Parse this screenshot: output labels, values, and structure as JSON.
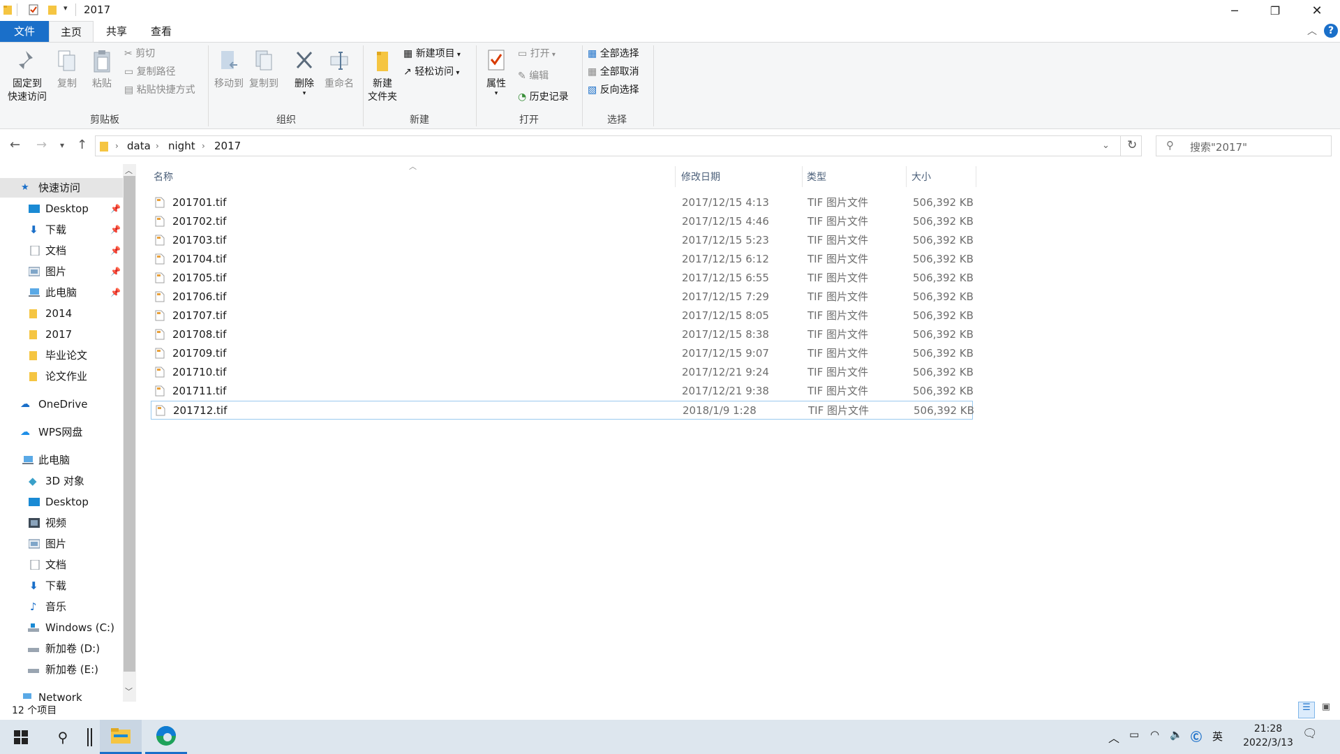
{
  "window": {
    "title": "2017"
  },
  "tabs": {
    "file": "文件",
    "home": "主页",
    "share": "共享",
    "view": "查看"
  },
  "ribbon": {
    "clipboard": {
      "pin": "固定到\n快速访问",
      "pin_l1": "固定到",
      "pin_l2": "快速访问",
      "copy": "复制",
      "paste": "粘贴",
      "cut": "剪切",
      "copy_path": "复制路径",
      "paste_shortcut": "粘贴快捷方式",
      "label": "剪贴板"
    },
    "organize": {
      "move_to": "移动到",
      "copy_to": "复制到",
      "delete": "删除",
      "rename": "重命名",
      "label": "组织"
    },
    "new": {
      "new_folder_l1": "新建",
      "new_folder_l2": "文件夹",
      "new_item": "新建项目",
      "easy_access": "轻松访问",
      "label": "新建"
    },
    "open": {
      "properties": "属性",
      "open": "打开",
      "edit": "编辑",
      "history": "历史记录",
      "label": "打开"
    },
    "select": {
      "select_all": "全部选择",
      "select_none": "全部取消",
      "invert": "反向选择",
      "label": "选择"
    }
  },
  "address": {
    "crumbs": [
      "data",
      "night",
      "2017"
    ],
    "search_placeholder": "搜索\"2017\""
  },
  "sidebar": {
    "quick_access": "快速访问",
    "quick_items": [
      "Desktop",
      "下载",
      "文档",
      "图片",
      "此电脑",
      "2014",
      "2017",
      "毕业论文",
      "论文作业"
    ],
    "onedrive": "OneDrive",
    "wps": "WPS网盘",
    "this_pc": "此电脑",
    "pc_items": [
      "3D 对象",
      "Desktop",
      "视频",
      "图片",
      "文档",
      "下载",
      "音乐",
      "Windows (C:)",
      "新加卷 (D:)",
      "新加卷 (E:)"
    ],
    "network": "Network"
  },
  "columns": {
    "name": "名称",
    "date": "修改日期",
    "type": "类型",
    "size": "大小"
  },
  "files": [
    {
      "name": "201701.tif",
      "date": "2017/12/15 4:13",
      "type": "TIF 图片文件",
      "size": "506,392 KB"
    },
    {
      "name": "201702.tif",
      "date": "2017/12/15 4:46",
      "type": "TIF 图片文件",
      "size": "506,392 KB"
    },
    {
      "name": "201703.tif",
      "date": "2017/12/15 5:23",
      "type": "TIF 图片文件",
      "size": "506,392 KB"
    },
    {
      "name": "201704.tif",
      "date": "2017/12/15 6:12",
      "type": "TIF 图片文件",
      "size": "506,392 KB"
    },
    {
      "name": "201705.tif",
      "date": "2017/12/15 6:55",
      "type": "TIF 图片文件",
      "size": "506,392 KB"
    },
    {
      "name": "201706.tif",
      "date": "2017/12/15 7:29",
      "type": "TIF 图片文件",
      "size": "506,392 KB"
    },
    {
      "name": "201707.tif",
      "date": "2017/12/15 8:05",
      "type": "TIF 图片文件",
      "size": "506,392 KB"
    },
    {
      "name": "201708.tif",
      "date": "2017/12/15 8:38",
      "type": "TIF 图片文件",
      "size": "506,392 KB"
    },
    {
      "name": "201709.tif",
      "date": "2017/12/15 9:07",
      "type": "TIF 图片文件",
      "size": "506,392 KB"
    },
    {
      "name": "201710.tif",
      "date": "2017/12/21 9:24",
      "type": "TIF 图片文件",
      "size": "506,392 KB"
    },
    {
      "name": "201711.tif",
      "date": "2017/12/21 9:38",
      "type": "TIF 图片文件",
      "size": "506,392 KB"
    },
    {
      "name": "201712.tif",
      "date": "2018/1/9 1:28",
      "type": "TIF 图片文件",
      "size": "506,392 KB"
    }
  ],
  "status": {
    "count": "12 个项目"
  },
  "taskbar": {
    "time": "21:28",
    "date": "2022/3/13",
    "ime": "英"
  },
  "colors": {
    "accent": "#1a6fc9",
    "folder": "#f5c542",
    "selection_border": "#99c9ef"
  }
}
